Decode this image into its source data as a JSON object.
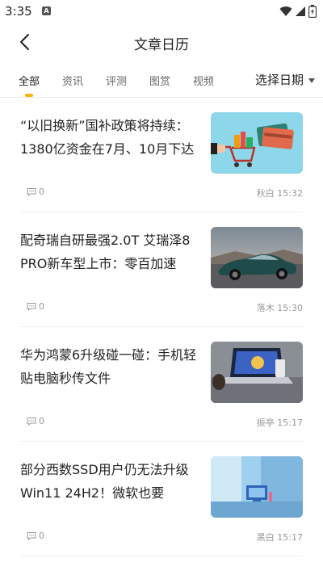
{
  "status_bar": {
    "time": "3:35",
    "notification_icon": "A"
  },
  "app_bar": {
    "title": "文章日历"
  },
  "tabs": [
    {
      "label": "全部",
      "active": true
    },
    {
      "label": "资讯",
      "active": false
    },
    {
      "label": "评测",
      "active": false
    },
    {
      "label": "图赏",
      "active": false
    },
    {
      "label": "视频",
      "active": false
    }
  ],
  "date_picker": {
    "label": "选择日期"
  },
  "colors": {
    "accent": "#f5b800",
    "text": "#222222",
    "meta": "#999999"
  },
  "articles": [
    {
      "title": "“以旧换新”国补政策将持续：1380亿资金在7月、10月下达",
      "comments": "0",
      "author": "秋白",
      "time": "15:32",
      "thumb": "shopping-cart-illustration"
    },
    {
      "title": "配奇瑞自研最强2.0T 艾瑞泽8 PRO新车型上市：零百加速",
      "comments": "0",
      "author": "落木",
      "time": "15:30",
      "thumb": "car-photo"
    },
    {
      "title": "华为鸿蒙6升级碰一碰：手机轻贴电脑秒传文件",
      "comments": "0",
      "author": "振亭",
      "time": "15:17",
      "thumb": "laptop-photo"
    },
    {
      "title": "部分西数SSD用户仍无法升级Win11 24H2！微软也要",
      "comments": "0",
      "author": "黑白",
      "time": "15:17",
      "thumb": "windows-illustration"
    }
  ]
}
